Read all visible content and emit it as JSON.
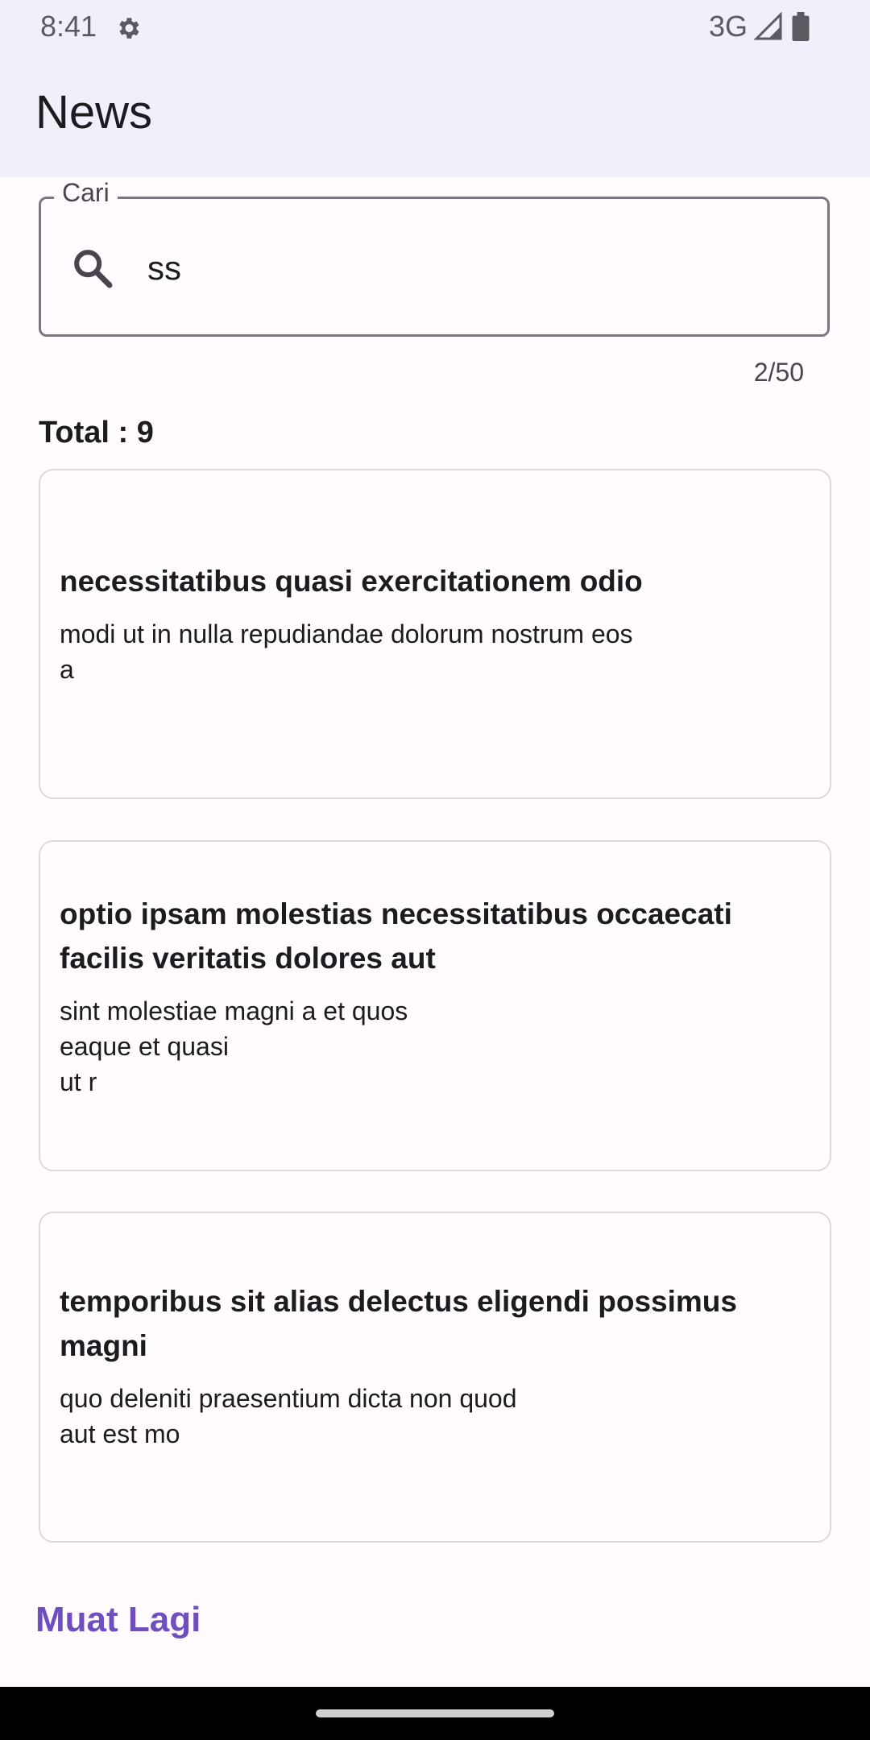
{
  "status_bar": {
    "time": "8:41",
    "network": "3G"
  },
  "app_bar": {
    "title": "News"
  },
  "search": {
    "label": "Cari",
    "value": "ss",
    "counter": "2/50"
  },
  "results": {
    "total": "Total : 9",
    "items": [
      {
        "title": "necessitatibus quasi exercitationem odio",
        "body": "modi ut in nulla repudiandae dolorum nostrum eos\na"
      },
      {
        "title": "optio ipsam molestias necessitatibus occaecati facilis veritatis dolores aut",
        "body": "sint molestiae magni a et quos\neaque et quasi\nut r"
      },
      {
        "title": "temporibus sit alias delectus eligendi possimus magni",
        "body": "quo deleniti praesentium dicta non quod\naut est mo"
      }
    ]
  },
  "load_more": {
    "label": "Muat Lagi"
  },
  "colors": {
    "app_bar_bg": "#f3effa",
    "accent": "#6f4ec0",
    "card_border": "#dcd8e0"
  },
  "icons": [
    "settings-gear-icon",
    "signal-icon",
    "battery-icon",
    "search-icon"
  ]
}
